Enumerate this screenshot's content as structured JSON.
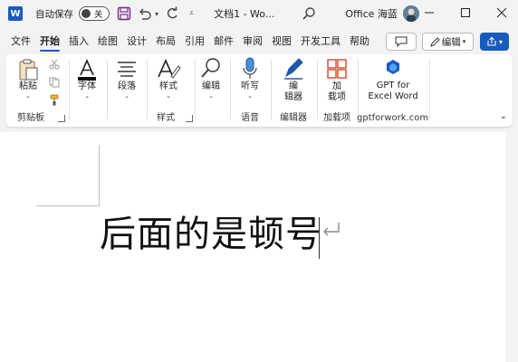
{
  "titlebar": {
    "app_letter": "W",
    "autosave_label": "自动保存",
    "autosave_state": "关",
    "doc_title": "文档1 - Wo...",
    "account_name": "Office 海蓝"
  },
  "menu": {
    "tabs": [
      "文件",
      "开始",
      "插入",
      "绘图",
      "设计",
      "布局",
      "引用",
      "邮件",
      "审阅",
      "视图",
      "开发工具",
      "帮助"
    ],
    "active_tab": "开始",
    "edit_mode_label": "编辑"
  },
  "ribbon": {
    "clipboard": {
      "paste_label": "粘贴",
      "group_label": "剪贴板"
    },
    "font": {
      "font_label": "字体"
    },
    "paragraph": {
      "paragraph_label": "段落"
    },
    "styles": {
      "styles_label": "样式",
      "group_label": "样式"
    },
    "editing": {
      "editing_label": "编辑"
    },
    "voice": {
      "dictate_label": "听写",
      "group_label": "语音"
    },
    "editor": {
      "editor_label_1": "编",
      "editor_label_2": "辑器",
      "group_label": "编辑器"
    },
    "addins": {
      "addins_label_1": "加",
      "addins_label_2": "载项",
      "group_label": "加载项"
    },
    "gpt": {
      "label_1": "GPT for",
      "label_2": "Excel Word",
      "group_label": "gptforwork.com"
    }
  },
  "document": {
    "text": "后面的是顿号"
  },
  "colors": {
    "accent": "#185abd",
    "save_icon": "#7a2a8a",
    "addins_icon": "#d9452b",
    "editor_icon": "#1f5aa6"
  }
}
